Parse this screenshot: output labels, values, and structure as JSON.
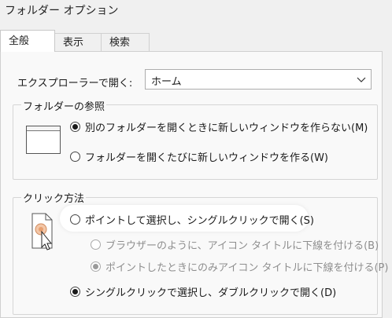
{
  "window": {
    "title": "フォルダー オプション"
  },
  "tabs": [
    {
      "label": "全般",
      "active": true
    },
    {
      "label": "表示",
      "active": false
    },
    {
      "label": "検索",
      "active": false
    }
  ],
  "explorer_open": {
    "label": "エクスプローラーで開く:",
    "selected": "ホーム"
  },
  "browse_folders": {
    "legend": "フォルダーの参照",
    "options": [
      {
        "label": "別のフォルダーを開くときに新しいウィンドウを作らない(M)",
        "checked": true
      },
      {
        "label": "フォルダーを開くたびに新しいウィンドウを作る(W)",
        "checked": false
      }
    ]
  },
  "click_method": {
    "legend": "クリック方法",
    "single_click": {
      "label": "ポイントして選択し、シングルクリックで開く(S)",
      "checked": false
    },
    "underline_options": [
      {
        "label": "ブラウザーのように、アイコン タイトルに下線を付ける(B)",
        "checked": false,
        "disabled": true
      },
      {
        "label": "ポイントしたときにのみアイコン タイトルに下線を付ける(P)",
        "checked": true,
        "disabled": true
      }
    ],
    "double_click": {
      "label": "シングルクリックで選択し、ダブルクリックで開く(D)",
      "checked": true
    }
  },
  "colors": {
    "background": "#f0f0f0",
    "panel": "#f9f9f9",
    "highlight": "#ffffff",
    "disabled_text": "#8e8e8e",
    "cursor_accent": "#e8a070"
  }
}
